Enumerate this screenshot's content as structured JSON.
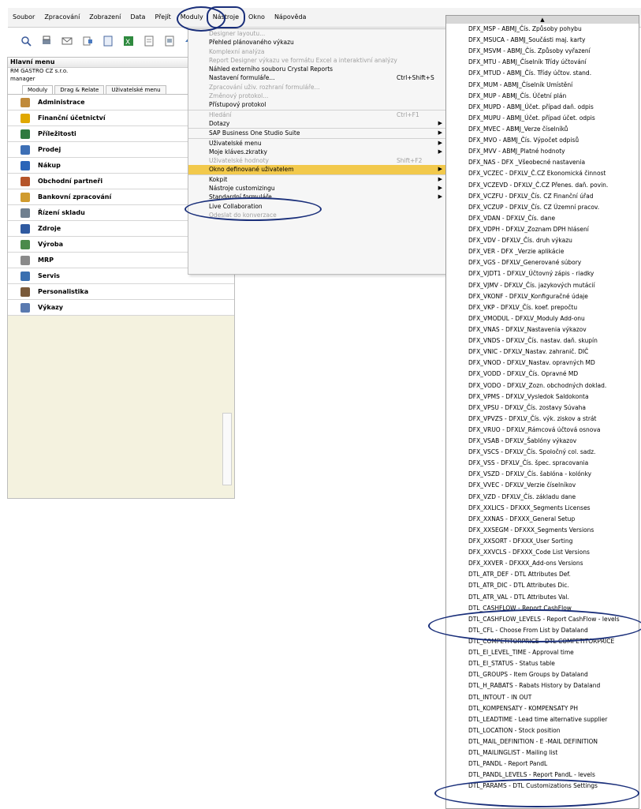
{
  "menubar": [
    "Soubor",
    "Zpracování",
    "Zobrazení",
    "Data",
    "Přejít",
    "Moduly",
    "Nástroje",
    "Okno",
    "Nápověda"
  ],
  "toolbar_icons": [
    "search-icon",
    "print-icon",
    "mail-icon",
    "export-icon",
    "document-icon",
    "excel-icon",
    "report-icon",
    "preview-icon",
    "arrow-up-icon",
    "filter-icon"
  ],
  "main_menu": {
    "title": "Hlavní menu",
    "company": "RM GASTRO CZ s.r.o.",
    "user": "manager",
    "tabs": [
      "Moduly",
      "Drag & Relate",
      "Uživatelské menu"
    ],
    "modules": [
      {
        "label": "Administrace",
        "color": "#c08a3a"
      },
      {
        "label": "Finanční účetnictví",
        "color": "#e0a800"
      },
      {
        "label": "Příležitosti",
        "color": "#2f7a3f"
      },
      {
        "label": "Prodej",
        "color": "#3d6fb5"
      },
      {
        "label": "Nákup",
        "color": "#2b65b8"
      },
      {
        "label": "Obchodní partneři",
        "color": "#b5552a"
      },
      {
        "label": "Bankovní zpracování",
        "color": "#d09b2e"
      },
      {
        "label": "Řízení skladu",
        "color": "#6f7f8f"
      },
      {
        "label": "Zdroje",
        "color": "#2f5aa0"
      },
      {
        "label": "Výroba",
        "color": "#4a8a4a"
      },
      {
        "label": "MRP",
        "color": "#8a8a8a"
      },
      {
        "label": "Servis",
        "color": "#3a6fb0"
      },
      {
        "label": "Personalistika",
        "color": "#7a5a3a"
      },
      {
        "label": "Výkazy",
        "color": "#5a7ab0"
      }
    ]
  },
  "dropdown": [
    {
      "label": "Designer layoutu...",
      "disabled": true
    },
    {
      "label": "Přehled plánovaného výkazu"
    },
    {
      "label": "Komplexní analýza",
      "disabled": true
    },
    {
      "label": "Report Designer výkazu ve formátu Excel a interaktivní analýzy",
      "disabled": true
    },
    {
      "label": "Náhled externího souboru Crystal Reports"
    },
    {
      "label": "Nastavení formuláře...",
      "shortcut": "Ctrl+Shift+S"
    },
    {
      "label": "Zpracování uživ. rozhraní formuláře...",
      "disabled": true
    },
    {
      "label": "Změnový protokol...",
      "disabled": true
    },
    {
      "label": "Přístupový protokol"
    },
    {
      "label": "Hledání",
      "disabled": true,
      "shortcut": "Ctrl+F1",
      "sep": true
    },
    {
      "label": "Dotazy",
      "arrow": true
    },
    {
      "label": "SAP Business One Studio Suite",
      "arrow": true,
      "sep": true
    },
    {
      "label": "Uživatelské menu",
      "arrow": true,
      "sep": true
    },
    {
      "label": "Moje kláves.zkratky",
      "arrow": true
    },
    {
      "label": "Uživatelské hodnoty",
      "disabled": true,
      "shortcut": "Shift+F2"
    },
    {
      "label": "Okno definované uživatelem",
      "arrow": true,
      "highlight": true
    },
    {
      "label": "Kokpit",
      "arrow": true,
      "sep": true
    },
    {
      "label": "Nástroje customizingu",
      "arrow": true
    },
    {
      "label": "Standardní formuláře",
      "arrow": true
    },
    {
      "label": "Live Collaboration"
    },
    {
      "label": "Odeslat do konverzace",
      "disabled": true
    }
  ],
  "submenu": [
    "DFX_MSP - ABMJ_Čís. Způsoby pohybu",
    "DFX_MSUCA - ABMJ_Součásti maj. karty",
    "DFX_MSVM - ABMJ_Čís. Způsoby vyřazení",
    "DFX_MTU - ABMJ_Číselník Třídy účtování",
    "DFX_MTUD - ABMJ_Čís. Třídy účtov. stand.",
    "DFX_MUM - ABMJ_Číselník Umístění",
    "DFX_MUP - ABMJ_Čís. Účetní plán",
    "DFX_MUPD - ABMJ_Účet. případ daň. odpis",
    "DFX_MUPU - ABMJ_Účet. případ účet. odpis",
    "DFX_MVEC - ABMJ_Verze číselníků",
    "DFX_MVO - ABMJ_Čís. Výpočet odpisů",
    "DFX_MVV - ABMJ_Platné hodnoty",
    "DFX_NAS - DFX _Všeobecné nastavenia",
    "DFX_VCZEC - DFXLV_Č.CZ Ekonomická činnost",
    "DFX_VCZEVD - DFXLV_Č.CZ Přenes. daň. povin.",
    "DFX_VCZFU - DFXLV_Čís. CZ Finanční úřad",
    "DFX_VCZUP - DFXLV_Čís. CZ Územní pracov.",
    "DFX_VDAN - DFXLV_Čís. dane",
    "DFX_VDPH - DFXLV_Zoznam DPH hlásení",
    "DFX_VDV - DFXLV_Čís. druh výkazu",
    "DFX_VER - DFX _Verzie aplikácie",
    "DFX_VGS - DFXLV_Generované súbory",
    "DFX_VJDT1 - DFXLV_Účtovný zápis - riadky",
    "DFX_VJMV - DFXLV_Čís. jazykových mutácií",
    "DFX_VKONF - DFXLV_Konfiguračné údaje",
    "DFX_VKP - DFXLV_Čís. koef. prepočtu",
    "DFX_VMODUL - DFXLV_Moduly Add-onu",
    "DFX_VNAS - DFXLV_Nastavenia výkazov",
    "DFX_VNDS - DFXLV_Čís. nastav. daň. skupín",
    "DFX_VNIC - DFXLV_Nastav. zahranič. DIČ",
    "DFX_VNOD - DFXLV_Nastav. opravných MD",
    "DFX_VODD - DFXLV_Čís. Opravné MD",
    "DFX_VODO - DFXLV_Zozn. obchodných doklad.",
    "DFX_VPMS - DFXLV_Vysledok Saldokonta",
    "DFX_VPSU - DFXLV_Čís. zostavy Súvaha",
    "DFX_VPVZS - DFXLV_Čís. výk. ziskov a strát",
    "DFX_VRUO - DFXLV_Rámcová účtová osnova",
    "DFX_VSAB - DFXLV_Šablóny výkazov",
    "DFX_VSCS - DFXLV_Čís. Spoločný col. sadz.",
    "DFX_VSS - DFXLV_Čís. špec. spracovania",
    "DFX_VSZD - DFXLV_Čís. šablóna - kolónky",
    "DFX_VVEC - DFXLV_Verzie číselníkov",
    "DFX_VZD - DFXLV_Čís. základu dane",
    "DFX_XXLICS - DFXXX_Segments Licenses",
    "DFX_XXNAS - DFXXX_General Setup",
    "DFX_XXSEGM - DFXXX_Segments Versions",
    "DFX_XXSORT - DFXXX_User Sorting",
    "DFX_XXVCLS - DFXXX_Code List Versions",
    "DFX_XXVER - DFXXX_Add-ons Versions",
    "DTL_ATR_DEF - DTL Attributes Def.",
    "DTL_ATR_DIC - DTL Attributes Dic.",
    "DTL_ATR_VAL - DTL Attributes Val.",
    "DTL_CASHFLOW - Report CashFlow",
    "DTL_CASHFLOW_LEVELS - Report CashFlow - levels",
    "DTL_CFL - Choose From List by Dataland",
    "DTL_COMPETITORPRICE - DTL COMPETITORPRICE",
    "DTL_EI_LEVEL_TIME - Approval time",
    "DTL_EI_STATUS - Status table",
    "DTL_GROUPS - Item Groups by Dataland",
    "DTL_H_RABATS - Rabats History by Dataland",
    "DTL_INTOUT - IN OUT",
    "DTL_KOMPENSATY - KOMPENSATY PH",
    "DTL_LEADTIME - Lead time alternative supplier",
    "DTL_LOCATION - Stock position",
    "DTL_MAIL_DEFINITION - E -MAIL DEFINITION",
    "DTL_MAILINGLIST - Mailing list",
    "DTL_PANDL - Report PandL",
    "DTL_PANDL_LEVELS - Report PandL - levels",
    "DTL_PARAMS - DTL Customizations Settings"
  ]
}
